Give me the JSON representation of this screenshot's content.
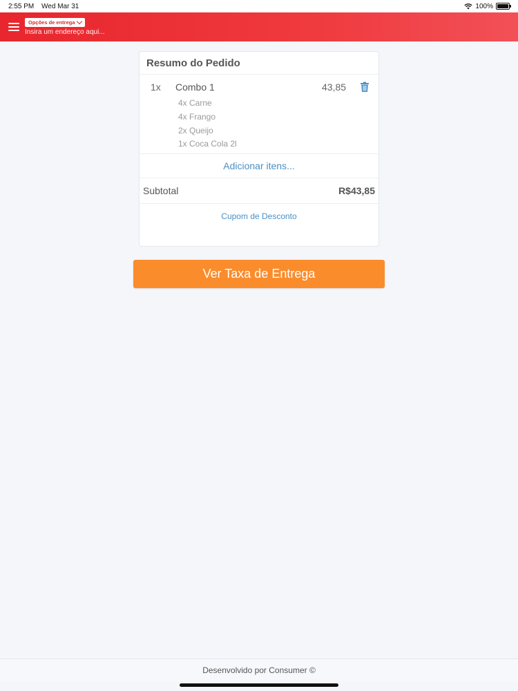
{
  "status_bar": {
    "time": "2:55 PM",
    "date": "Wed Mar 31",
    "battery": "100%",
    "battery_level": 1.0
  },
  "header": {
    "delivery_options_label": "Opções de entrega",
    "address_placeholder": "Insira um endereço aqui...",
    "gradient_start": "#e8262d",
    "gradient_end": "#f25057"
  },
  "order_summary": {
    "title": "Resumo do Pedido",
    "items": [
      {
        "qty": "1x",
        "name": "Combo 1",
        "price": "43,85",
        "details": [
          "4x Carne",
          "4x Frango",
          "2x Queijo",
          "1x Coca Cola 2l"
        ]
      }
    ],
    "add_items_label": "Adicionar itens...",
    "subtotal_label": "Subtotal",
    "subtotal_value": "R$43,85",
    "coupon_label": "Cupom de Desconto"
  },
  "cta": {
    "label": "Ver Taxa de Entrega",
    "color": "#fb8c2b"
  },
  "footer": {
    "text": "Desenvolvido por Consumer ©"
  },
  "colors": {
    "link": "#4a90c6",
    "background": "#f5f6fa"
  }
}
